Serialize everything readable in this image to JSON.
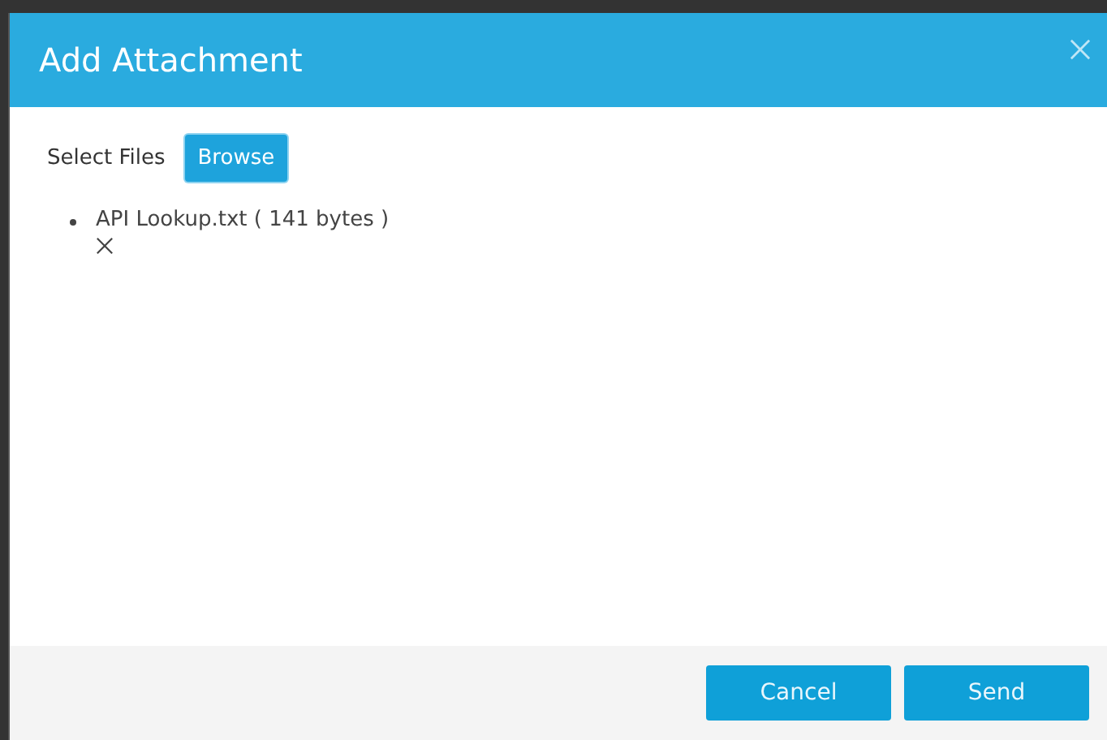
{
  "dialog": {
    "title": "Add Attachment",
    "select_label": "Select Files",
    "browse_button": "Browse",
    "files": [
      {
        "name": "API Lookup.txt ( 141 bytes )"
      }
    ],
    "buttons": [
      {
        "label": "Cancel"
      },
      {
        "label": "Send"
      }
    ]
  }
}
